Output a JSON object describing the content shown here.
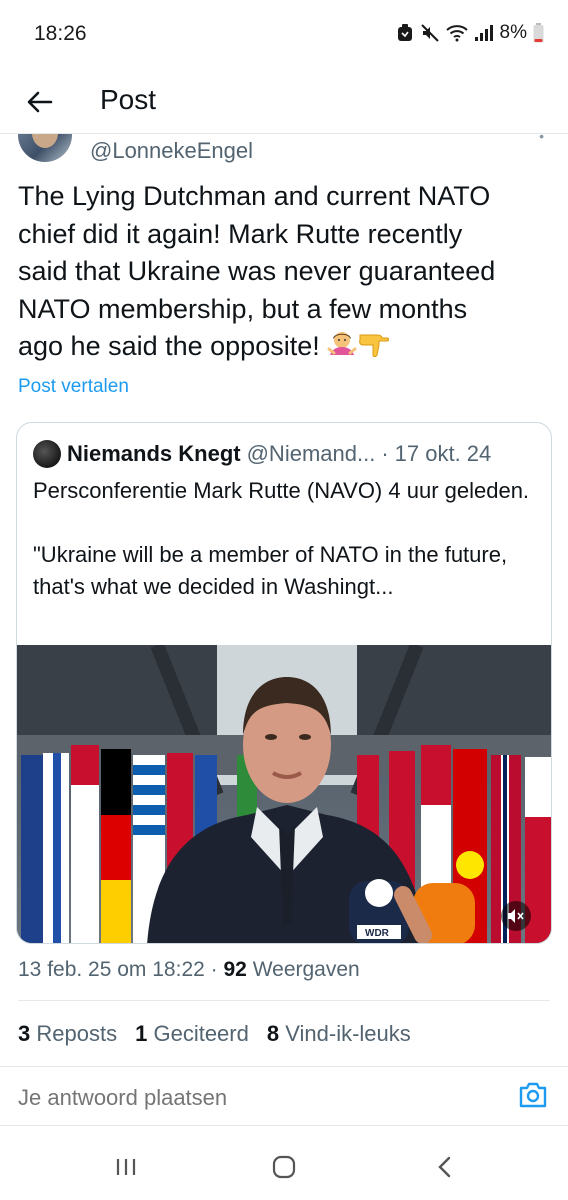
{
  "status_bar": {
    "time": "18:26",
    "battery": "8%",
    "icons": [
      "alarm-icon",
      "mute-icon",
      "wifi-icon",
      "signal-icon",
      "battery-low-icon"
    ],
    "battery_color": "#e53935"
  },
  "header": {
    "title": "Post",
    "back_icon": "arrow-left-icon"
  },
  "post": {
    "author_handle": "@LonnekeEngel",
    "text_line_1": "The Lying Dutchman and current NATO",
    "text_line_2": "chief did it again! Mark Rutte recently",
    "text_line_3": "said that Ukraine was never guaranteed",
    "text_line_4": "NATO membership, but a few months",
    "text_line_5": "ago he said the opposite! ",
    "emojis": [
      "woman-shrugging-emoji",
      "pointing-down-emoji"
    ],
    "translate_label": "Post vertalen",
    "link_color": "#1d9bf0"
  },
  "quote": {
    "name": "Niemands Knegt",
    "handle": "@Niemand...",
    "separator": "·",
    "date": "17 okt. 24",
    "text": "Persconferentie Mark Rutte (NAVO) 4 uur geleden.\n\n\"Ukraine will be a member of NATO in the future, that's what we decided in Washingt...",
    "media_mute_icon": "speaker-muted-icon",
    "mic_label": "WDR"
  },
  "meta": {
    "timestamp": "13 feb. 25 om 18:22",
    "separator": "·",
    "views_count": "92",
    "views_label": "Weergaven"
  },
  "stats": {
    "reposts_count": "3",
    "reposts_label": "Reposts",
    "quotes_count": "1",
    "quotes_label": "Geciteerd",
    "likes_count": "8",
    "likes_label": "Vind-ik-leuks"
  },
  "reply": {
    "placeholder": "Je antwoord plaatsen",
    "camera_icon": "camera-icon"
  },
  "android_nav": {
    "recent_icon": "recent-apps-icon",
    "home_icon": "home-icon",
    "back_icon": "back-chevron-icon"
  }
}
